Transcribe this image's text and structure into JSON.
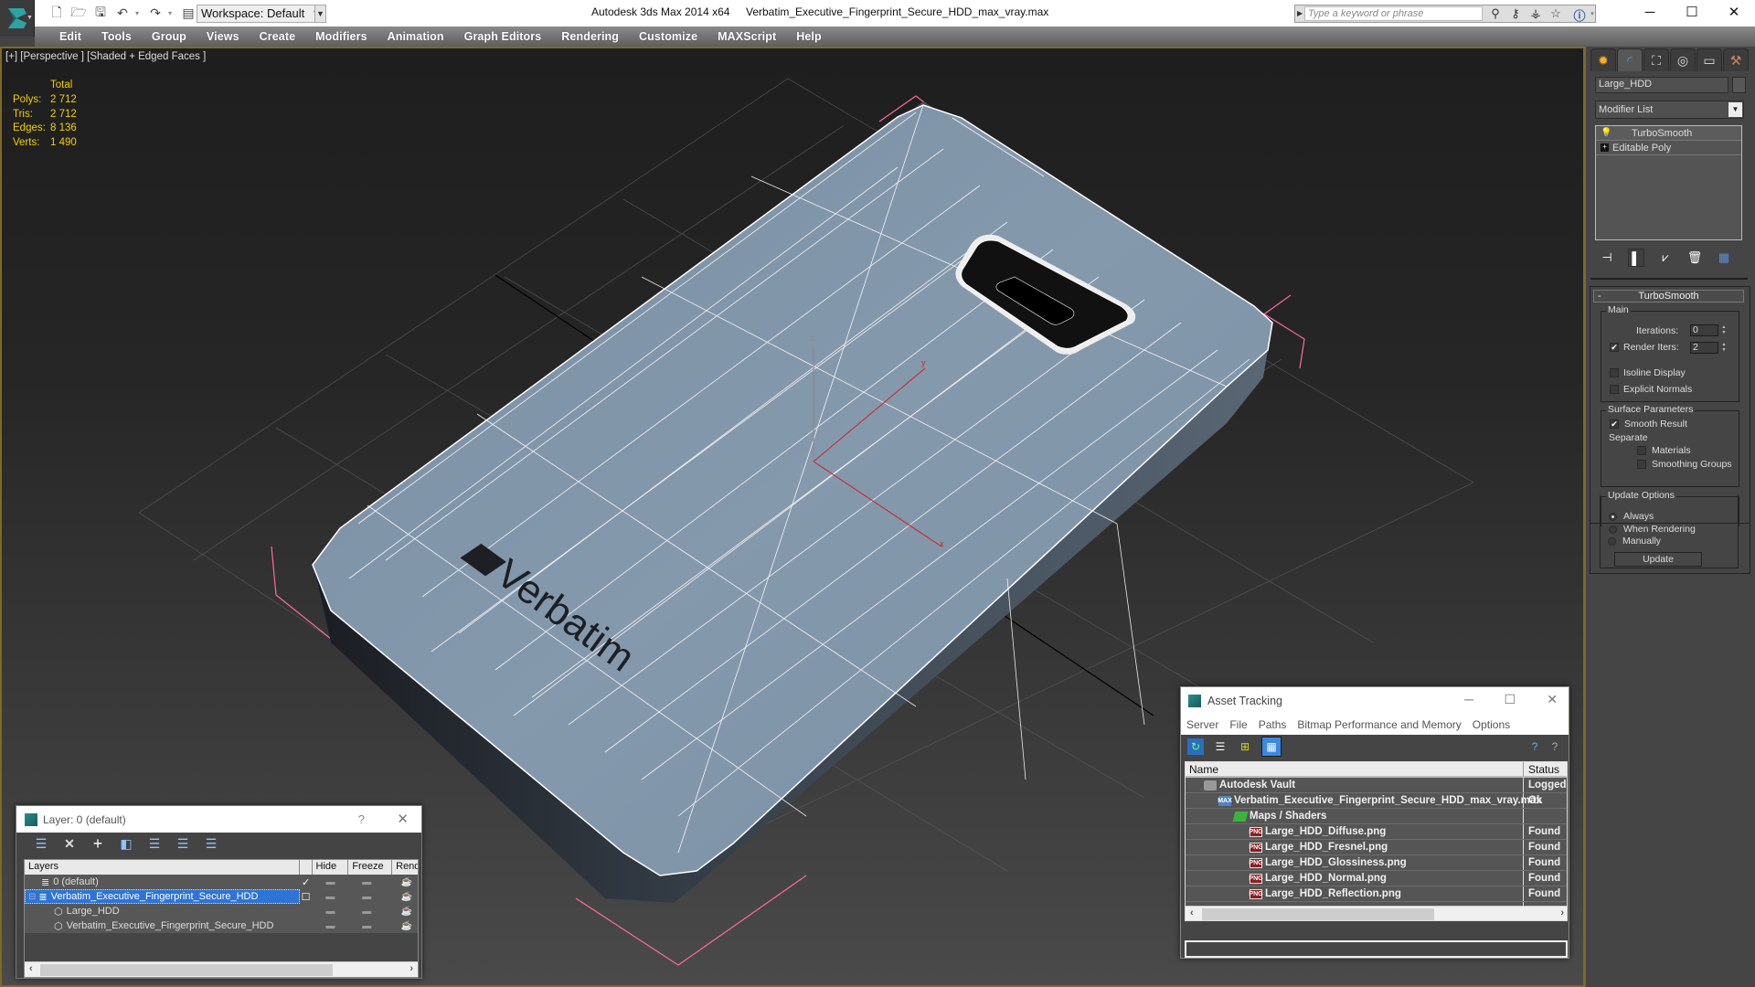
{
  "titlebar": {
    "app_title": "Autodesk 3ds Max  2014 x64",
    "doc_title": "Verbatim_Executive_Fingerprint_Secure_HDD_max_vray.max",
    "workspace": "Workspace: Default",
    "search_placeholder": "Type a keyword or phrase",
    "qat_icons": [
      "new-file-icon",
      "open-file-icon",
      "save-icon",
      "undo-icon",
      "redo-icon",
      "project-folder-icon"
    ],
    "search_tools": [
      "binoculars-icon",
      "key-icon",
      "satellite-icon",
      "star-icon",
      "help-icon"
    ]
  },
  "menubar": {
    "items": [
      "Edit",
      "Tools",
      "Group",
      "Views",
      "Create",
      "Modifiers",
      "Animation",
      "Graph Editors",
      "Rendering",
      "Customize",
      "MAXScript",
      "Help"
    ]
  },
  "viewport": {
    "label": "[+] [Perspective ] [Shaded + Edged Faces ]",
    "stats": {
      "header": "Total",
      "rows": [
        {
          "key": "Polys:",
          "value": "2 712"
        },
        {
          "key": "Tris:",
          "value": "2 712"
        },
        {
          "key": "Edges:",
          "value": "8 136"
        },
        {
          "key": "Verts:",
          "value": "1 490"
        }
      ]
    },
    "model_logo_text": "Verbatim",
    "axis_labels": {
      "x": "x",
      "y": "y",
      "z": "z"
    }
  },
  "command_panel": {
    "tabs": [
      "create-icon",
      "modify-icon",
      "hierarchy-icon",
      "motion-icon",
      "display-icon",
      "utilities-icon"
    ],
    "object_name": "Large_HDD",
    "modifier_list": "Modifier List",
    "stack": [
      {
        "label": "TurboSmooth",
        "selected": true
      },
      {
        "label": "Editable Poly",
        "selected": false
      }
    ],
    "turbosmooth": {
      "title": "TurboSmooth",
      "main_group": "Main",
      "iterations_label": "Iterations:",
      "iterations": "0",
      "render_iters_label": "Render Iters:",
      "render_iters": "2",
      "render_iters_checked": "✔",
      "isoline_display": "Isoline Display",
      "explicit_normals": "Explicit Normals",
      "surface_group": "Surface Parameters",
      "smooth_result": "Smooth Result",
      "smooth_result_checked": "✔",
      "separate": "Separate",
      "materials": "Materials",
      "smoothing_groups": "Smoothing Groups",
      "update_group": "Update Options",
      "always": "Always",
      "when_rendering": "When Rendering",
      "manually": "Manually",
      "update_button": "Update"
    }
  },
  "layer_dialog": {
    "title": "Layer: 0 (default)",
    "help": "?",
    "columns": [
      "Layers",
      "",
      "Hide",
      "Freeze",
      "Rende"
    ],
    "rows": [
      {
        "name": "0 (default)",
        "current": "✓",
        "type": "layer"
      },
      {
        "name": "Verbatim_Executive_Fingerprint_Secure_HDD",
        "current": "",
        "type": "layer",
        "selected": true
      },
      {
        "name": "Large_HDD",
        "current": "",
        "type": "object"
      },
      {
        "name": "Verbatim_Executive_Fingerprint_Secure_HDD",
        "current": "",
        "type": "object"
      }
    ]
  },
  "asset_dialog": {
    "title": "Asset Tracking",
    "menu": [
      "Server",
      "File",
      "Paths",
      "Bitmap Performance and Memory",
      "Options"
    ],
    "columns": [
      "Name",
      "Status"
    ],
    "rows": [
      {
        "name": "Autodesk Vault",
        "status": "Logged",
        "icon": "vault"
      },
      {
        "name": "Verbatim_Executive_Fingerprint_Secure_HDD_max_vray.max",
        "status": "Ok",
        "icon": "max"
      },
      {
        "name": "Maps / Shaders",
        "status": "",
        "icon": "maps"
      },
      {
        "name": "Large_HDD_Diffuse.png",
        "status": "Found",
        "icon": "png"
      },
      {
        "name": "Large_HDD_Fresnel.png",
        "status": "Found",
        "icon": "png"
      },
      {
        "name": "Large_HDD_Glossiness.png",
        "status": "Found",
        "icon": "png"
      },
      {
        "name": "Large_HDD_Normal.png",
        "status": "Found",
        "icon": "png"
      },
      {
        "name": "Large_HDD_Reflection.png",
        "status": "Found",
        "icon": "png"
      }
    ]
  },
  "colors": {
    "viewport_border": "#7c6a2a",
    "stats_text": "#f2d000",
    "model_surface": "#8094a8",
    "selection_blue": "#2d74d6",
    "bbox_pink": "#ff6b9a"
  }
}
